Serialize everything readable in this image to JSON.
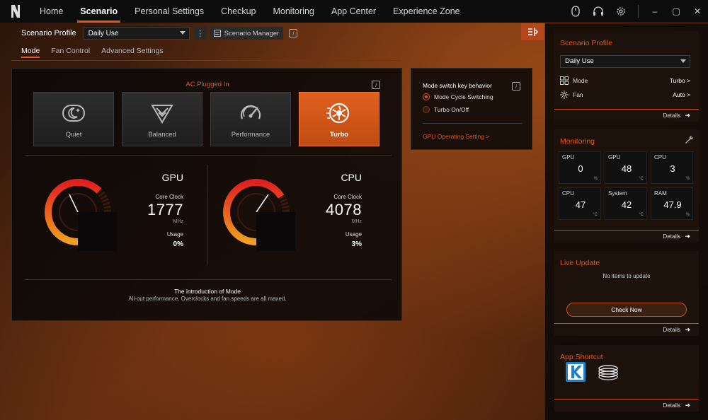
{
  "nav": {
    "items": [
      "Home",
      "Scenario",
      "Personal Settings",
      "Checkup",
      "Monitoring",
      "App Center",
      "Experience Zone"
    ],
    "active": "Scenario"
  },
  "window_controls": {
    "minimize": "–",
    "maximize": "▢",
    "close": "✕"
  },
  "scenario_profile": {
    "label": "Scenario Profile",
    "selected": "Daily Use",
    "manager_label": "Scenario Manager"
  },
  "subtabs": [
    "Mode",
    "Fan Control",
    "Advanced Settings"
  ],
  "mode": {
    "power_status": "AC Plugged In",
    "tiles": [
      {
        "label": "Quiet",
        "icon": "quiet-icon"
      },
      {
        "label": "Balanced",
        "icon": "balanced-icon"
      },
      {
        "label": "Performance",
        "icon": "performance-icon"
      },
      {
        "label": "Turbo",
        "icon": "turbo-icon"
      }
    ],
    "active": "Turbo"
  },
  "gpu": {
    "title": "GPU",
    "clock_label": "Core Clock",
    "clock": "1777",
    "unit": "MHz",
    "usage_label": "Usage",
    "usage": "0%"
  },
  "cpu": {
    "title": "CPU",
    "clock_label": "Core Clock",
    "clock": "4078",
    "unit": "MHz",
    "usage_label": "Usage",
    "usage": "3%"
  },
  "intro": {
    "title": "The introduction of Mode",
    "desc": "All-out performance. Overclocks and fan speeds are all maxed."
  },
  "key_behavior": {
    "title": "Mode switch key behavior",
    "options": [
      "Mode Cycle Switching",
      "Turbo On/Off"
    ],
    "selected": "Mode Cycle Switching",
    "gpu_link": "GPU Operating Setting >"
  },
  "right": {
    "scenario": {
      "title": "Scenario Profile",
      "selected": "Daily Use",
      "mode_label": "Mode",
      "mode_value": "Turbo >",
      "fan_label": "Fan",
      "fan_value": "Auto >"
    },
    "monitoring": {
      "title": "Monitoring",
      "tiles": [
        {
          "label": "GPU",
          "value": "0",
          "unit": "%"
        },
        {
          "label": "GPU",
          "value": "48",
          "unit": "°C"
        },
        {
          "label": "CPU",
          "value": "3",
          "unit": "%"
        },
        {
          "label": "CPU",
          "value": "47",
          "unit": "°C"
        },
        {
          "label": "System",
          "value": "42",
          "unit": "°C"
        },
        {
          "label": "RAM",
          "value": "47.9",
          "unit": "%"
        }
      ]
    },
    "live_update": {
      "title": "Live Update",
      "empty": "No items to update",
      "check": "Check Now"
    },
    "app_shortcut": {
      "title": "App Shortcut"
    },
    "details": "Details",
    "arrow": "➜"
  },
  "colors": {
    "accent": "#e2561a"
  }
}
